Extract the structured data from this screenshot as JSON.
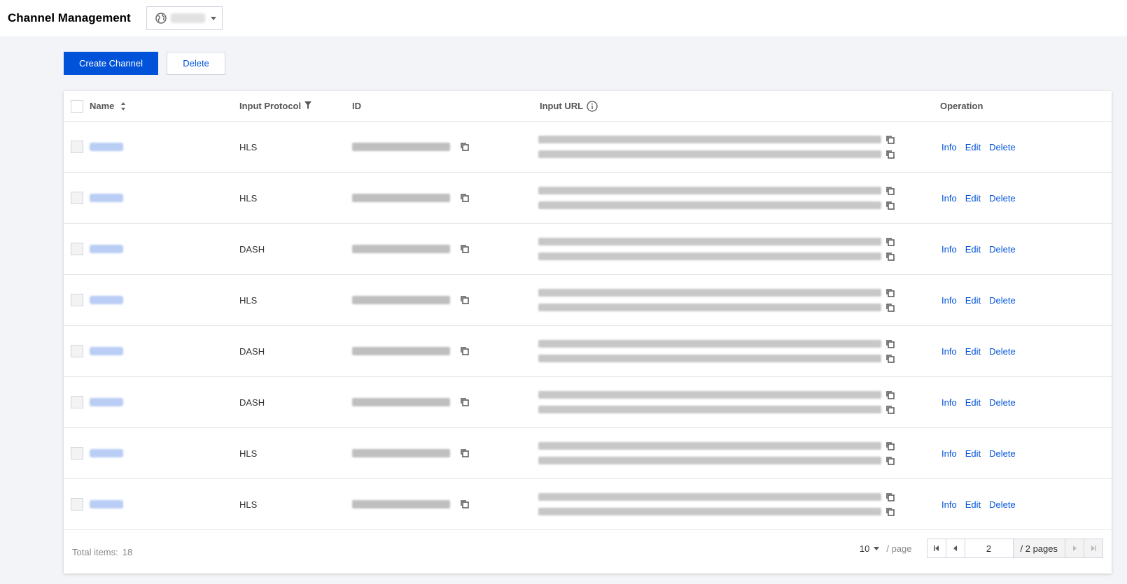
{
  "header": {
    "title": "Channel Management"
  },
  "toolbar": {
    "create_label": "Create Channel",
    "delete_label": "Delete"
  },
  "table": {
    "columns": {
      "name": "Name",
      "protocol": "Input Protocol",
      "id": "ID",
      "url": "Input URL",
      "operation": "Operation"
    },
    "rows": [
      {
        "protocol": "HLS"
      },
      {
        "protocol": "HLS"
      },
      {
        "protocol": "DASH"
      },
      {
        "protocol": "HLS"
      },
      {
        "protocol": "DASH"
      },
      {
        "protocol": "DASH"
      },
      {
        "protocol": "HLS"
      },
      {
        "protocol": "HLS"
      }
    ],
    "ops": {
      "info": "Info",
      "edit": "Edit",
      "delete": "Delete"
    }
  },
  "footer": {
    "total_label": "Total items:",
    "total_count": "18"
  },
  "pagination": {
    "page_size": "10",
    "per_page_label": "/ page",
    "current_page": "2",
    "total_pages_label": "/ 2 pages"
  },
  "icons": {
    "region": "globe-icon",
    "copy": "copy-icon",
    "sort": "sort-icon",
    "filter": "filter-icon",
    "info": "info-circle-icon"
  },
  "colors": {
    "primary": "#0052d9",
    "background": "#f2f4f7"
  }
}
